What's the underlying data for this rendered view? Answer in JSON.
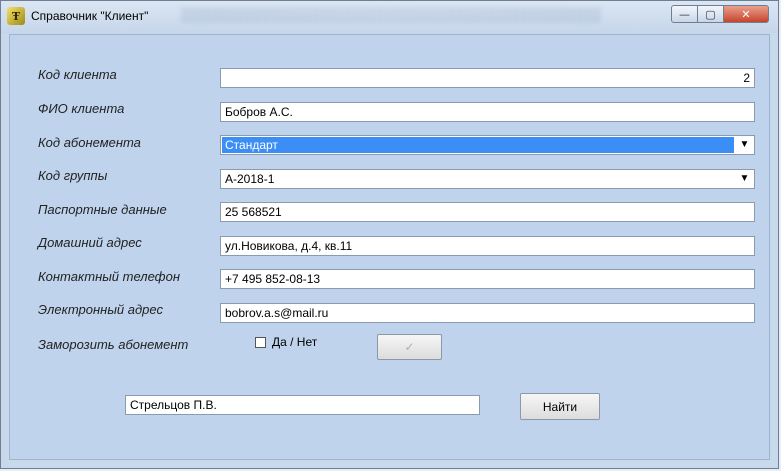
{
  "window": {
    "title": "Справочник \"Клиент\"",
    "icon_glyph": "Ŧ",
    "controls": {
      "minimize": "—",
      "maximize": "▢",
      "close": "✕"
    }
  },
  "form": {
    "fields": [
      {
        "label": "Код клиента",
        "value": "2"
      },
      {
        "label": "ФИО клиента",
        "value": "Бобров А.С."
      },
      {
        "label": "Код абонемента",
        "value": "Стандарт"
      },
      {
        "label": "Код группы",
        "value": "А-2018-1"
      },
      {
        "label": "Паспортные данные",
        "value": "25 568521"
      },
      {
        "label": "Домашний адрес",
        "value": "ул.Новикова, д.4, кв.11"
      },
      {
        "label": "Контактный телефон",
        "value": "+7 495 852-08-13"
      },
      {
        "label": "Электронный адрес",
        "value": "bobrov.a.s@mail.ru"
      }
    ],
    "freeze": {
      "label": "Заморозить абонемент",
      "checkbox_label": "Да / Нет",
      "checked": false,
      "ok_button_glyph": "✓"
    },
    "combo_arrow": "▼"
  },
  "search": {
    "value": "Стрельцов П.В.",
    "button_label": "Найти"
  },
  "colors": {
    "client_bg": "#bfd3ec",
    "selection": "#3a8ef6",
    "close_button": "#c8442c"
  }
}
